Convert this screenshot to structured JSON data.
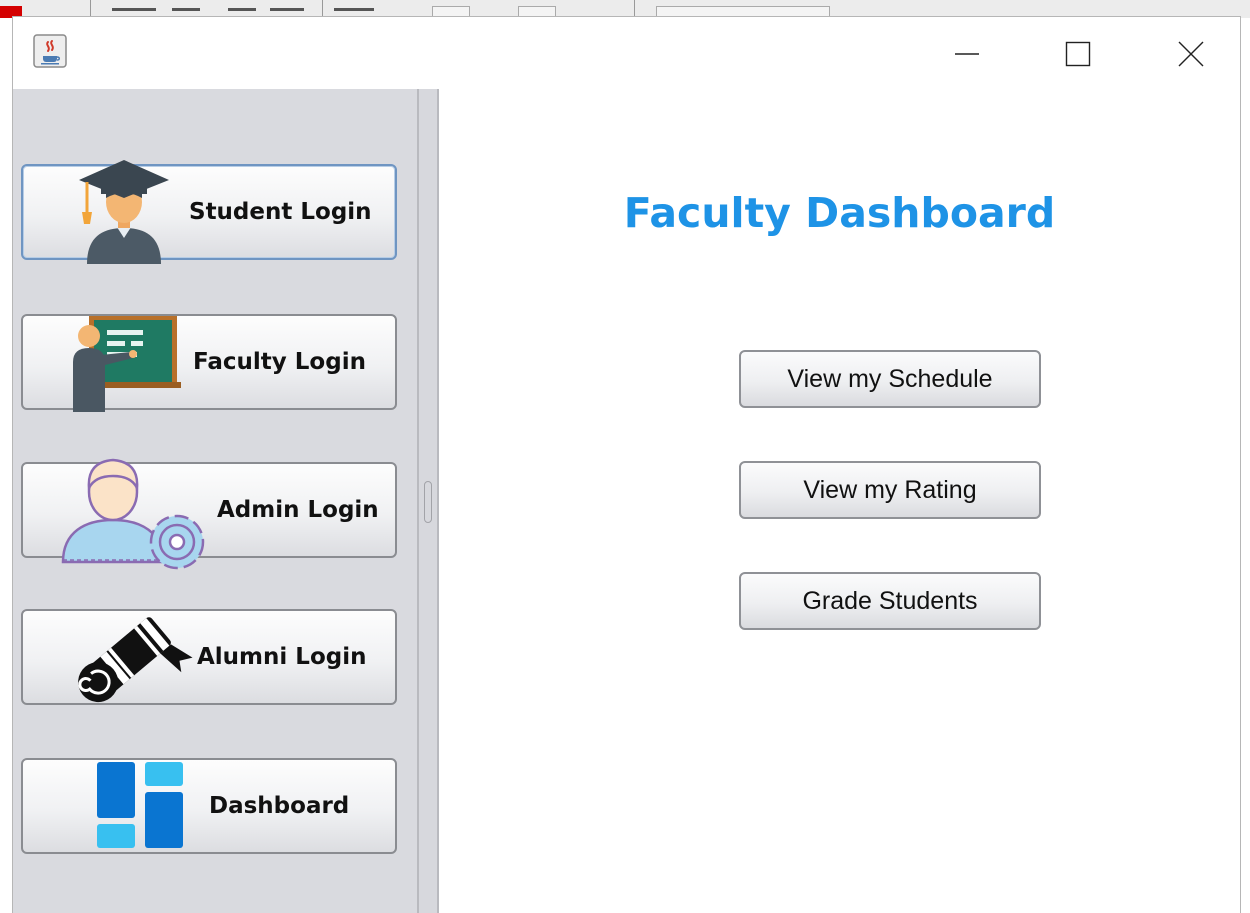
{
  "window": {
    "controls": {
      "minimize_icon": "minimize-icon",
      "maximize_icon": "maximize-icon",
      "close_icon": "close-icon"
    },
    "app_icon": "java-coffee-cup-icon"
  },
  "sidebar": {
    "items": [
      {
        "label": "Student Login",
        "icon": "graduate-icon"
      },
      {
        "label": "Faculty Login",
        "icon": "teacher-chalkboard-icon"
      },
      {
        "label": "Admin Login",
        "icon": "admin-gear-icon"
      },
      {
        "label": "Alumni Login",
        "icon": "diploma-scroll-icon"
      },
      {
        "label": "Dashboard",
        "icon": "dashboard-tiles-icon"
      }
    ]
  },
  "main": {
    "title": "Faculty Dashboard",
    "actions": [
      {
        "label": "View my Schedule"
      },
      {
        "label": "View my Rating"
      },
      {
        "label": "Grade Students"
      }
    ]
  },
  "colors": {
    "title": "#1e93e6",
    "sidebar_bg": "#d9dadf",
    "focus_border": "#6f95c2"
  }
}
